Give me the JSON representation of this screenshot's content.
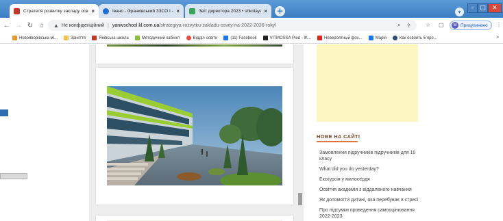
{
  "tabs": [
    {
      "title": "Стратегія розвитку закладу осв",
      "active": true,
      "favicon_color": "#c0392b"
    },
    {
      "title": "Івано - Франківський ЗЗСО І - ІІ",
      "active": false,
      "favicon_color": "#1d6fd3"
    },
    {
      "title": "Звіт директора 2023 • shkolaya",
      "active": false,
      "favicon_color": "#3aa35a"
    }
  ],
  "address": {
    "security_label": "Не конфіденційний",
    "domain": "yanivschool.kl.com.ua",
    "path": "/strategiya-rozvytku-zakladu-osvity-na-2022-2026-roky/"
  },
  "profile": {
    "initial": "M",
    "label": "Призупинено"
  },
  "bookmarks": [
    {
      "label": "Новояворівська мі...",
      "color": "#e69a2b"
    },
    {
      "label": "Заняття",
      "color": "#f2c14e"
    },
    {
      "label": "Янівська школа",
      "color": "#c0392b"
    },
    {
      "label": "Методичний кабінет",
      "color": "#8bbf3a"
    },
    {
      "label": "Відділ освіти",
      "color": "#e74c3c"
    },
    {
      "label": "(11) Facebook",
      "color": "#1877f2"
    },
    {
      "label": "VITMOSSA Pled - IK...",
      "color": "#222222"
    },
    {
      "label": "Невероятный фох...",
      "color": "#e62117"
    },
    {
      "label": "Марія",
      "color": "#1877f2"
    },
    {
      "label": "Как освоить 6 про...",
      "color": "#2b4b7a"
    }
  ],
  "sidebar": {
    "heading": "НОВЕ НА САЙТІ",
    "links": [
      "Замовлення підручників підручників для 10 класу",
      "What did you do yesterday?",
      "Екскурсія у милосердя",
      "Освітня академія з віддаленого навчання",
      "Як допомогти дитині, яка перебуває в стресі",
      "Про підсумки проведення самооцінювання 2022-2023"
    ]
  },
  "colors": {
    "tabstrip": "#3c7ec3",
    "sidebar_heading": "#7a4a2e",
    "accent_underline": "#e07a3c",
    "sidebar_box": "#fdf6c1"
  }
}
